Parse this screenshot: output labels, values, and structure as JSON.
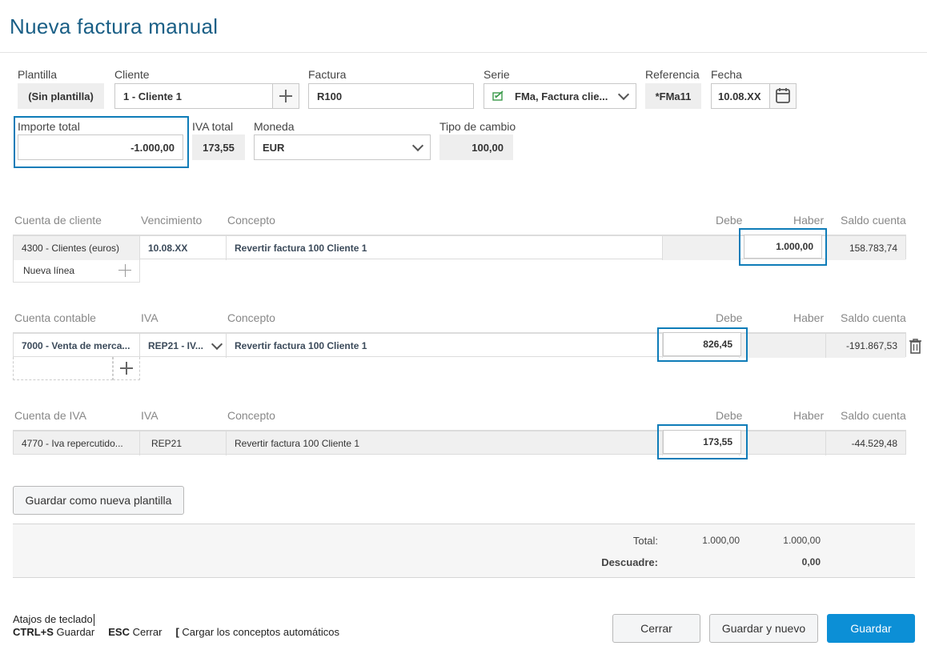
{
  "page": {
    "title": "Nueva factura manual"
  },
  "header_form": {
    "plantilla": {
      "label": "Plantilla",
      "value": "(Sin plantilla)"
    },
    "cliente": {
      "label": "Cliente",
      "value": "1 - Cliente 1"
    },
    "factura": {
      "label": "Factura",
      "value": "R100"
    },
    "serie": {
      "label": "Serie",
      "value": "FMa, Factura clie..."
    },
    "referencia": {
      "label": "Referencia",
      "value": "*FMa11"
    },
    "fecha": {
      "label": "Fecha",
      "value": "10.08.XX"
    },
    "importe_total": {
      "label": "Importe total",
      "value": "-1.000,00"
    },
    "iva_total": {
      "label": "IVA total",
      "value": "173,55"
    },
    "moneda": {
      "label": "Moneda",
      "value": "EUR"
    },
    "tipo_cambio": {
      "label": "Tipo de cambio",
      "value": "100,00"
    }
  },
  "client_section": {
    "headers": [
      "Cuenta de cliente",
      "Vencimiento",
      "Concepto",
      "Debe",
      "Haber",
      "Saldo cuenta"
    ],
    "row": {
      "cuenta": "4300 - Clientes (euros)",
      "vencimiento": "10.08.XX",
      "concepto": "Revertir factura 100 Cliente 1",
      "debe": "",
      "haber": "1.000,00",
      "saldo": "158.783,74"
    },
    "new_line": "Nueva línea"
  },
  "accounting_section": {
    "headers": [
      "Cuenta contable",
      "IVA",
      "Concepto",
      "Debe",
      "Haber",
      "Saldo cuenta"
    ],
    "row": {
      "cuenta": "7000 - Venta de merca...",
      "iva": "REP21 - IV...",
      "concepto": "Revertir factura 100 Cliente 1",
      "debe": "826,45",
      "haber": "",
      "saldo": "-191.867,53"
    }
  },
  "vat_section": {
    "headers": [
      "Cuenta de IVA",
      "IVA",
      "Concepto",
      "Debe",
      "Haber",
      "Saldo cuenta"
    ],
    "row": {
      "cuenta": "4770 - Iva repercutido...",
      "iva": "REP21",
      "concepto": "Revertir factura 100 Cliente 1",
      "debe": "173,55",
      "haber": "",
      "saldo": "-44.529,48"
    }
  },
  "save_template_button": "Guardar como nueva plantilla",
  "totals": {
    "total_label": "Total:",
    "total_debe": "1.000,00",
    "total_haber": "1.000,00",
    "descuadre_label": "Descuadre:",
    "descuadre_value": "0,00"
  },
  "shortcuts": {
    "title": "Atajos de teclado",
    "items": [
      {
        "key": "CTRL+S",
        "label": "Guardar"
      },
      {
        "key": "ESC",
        "label": "Cerrar"
      },
      {
        "key": "[",
        "label": "Cargar los conceptos automáticos"
      }
    ]
  },
  "footer_buttons": {
    "cerrar": "Cerrar",
    "guardar_nuevo": "Guardar y nuevo",
    "guardar": "Guardar"
  },
  "colors": {
    "title": "#1a5f86",
    "highlight": "#0e7cb8",
    "primary": "#0c8fd6"
  },
  "icons": {
    "add": "plus-icon",
    "calendar": "calendar-icon",
    "delete": "trash-icon",
    "serie": "invoice-series-icon",
    "dropdown": "chevron-down-icon"
  }
}
